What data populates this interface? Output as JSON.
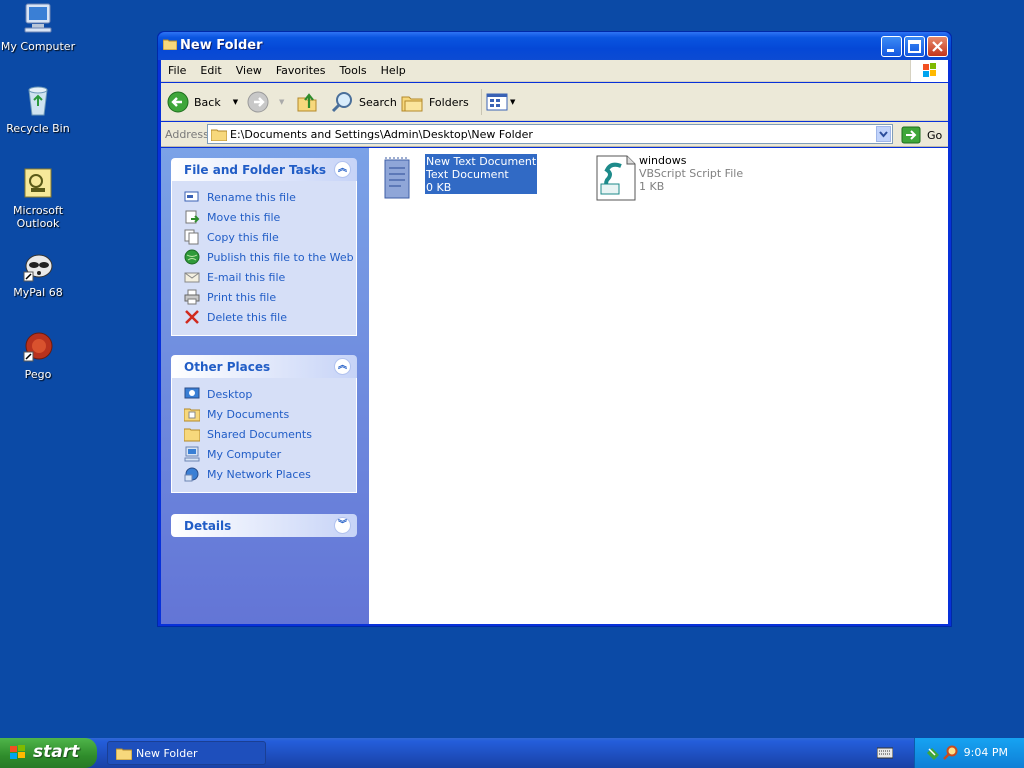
{
  "desktop": {
    "icons": [
      {
        "label": "My Computer"
      },
      {
        "label": "Recycle Bin"
      },
      {
        "label": "Microsoft Outlook"
      },
      {
        "label": "MyPal 68"
      },
      {
        "label": "Pego"
      }
    ]
  },
  "window": {
    "title": "New Folder",
    "menu": [
      "File",
      "Edit",
      "View",
      "Favorites",
      "Tools",
      "Help"
    ],
    "toolbar": {
      "back": "Back",
      "search": "Search",
      "folders": "Folders"
    },
    "address": {
      "label": "Address",
      "value": "E:\\Documents and Settings\\Admin\\Desktop\\New Folder",
      "go": "Go"
    },
    "taskpane": {
      "file_tasks": {
        "title": "File and Folder Tasks",
        "items": [
          "Rename this file",
          "Move this file",
          "Copy this file",
          "Publish this file to the Web",
          "E-mail this file",
          "Print this file",
          "Delete this file"
        ]
      },
      "other_places": {
        "title": "Other Places",
        "items": [
          "Desktop",
          "My Documents",
          "Shared Documents",
          "My Computer",
          "My Network Places"
        ]
      },
      "details": {
        "title": "Details"
      }
    },
    "files": [
      {
        "name": "New Text Document",
        "type": "Text Document",
        "size": "0 KB",
        "selected": true
      },
      {
        "name": "windows",
        "type": "VBScript Script File",
        "size": "1 KB",
        "selected": false
      }
    ]
  },
  "taskbar": {
    "start": "start",
    "task": "New Folder",
    "clock": "9:04 PM"
  },
  "colors": {
    "desktop": "#0b4aa6",
    "selection": "#316ac5",
    "taskpane_link": "#215dc6"
  }
}
